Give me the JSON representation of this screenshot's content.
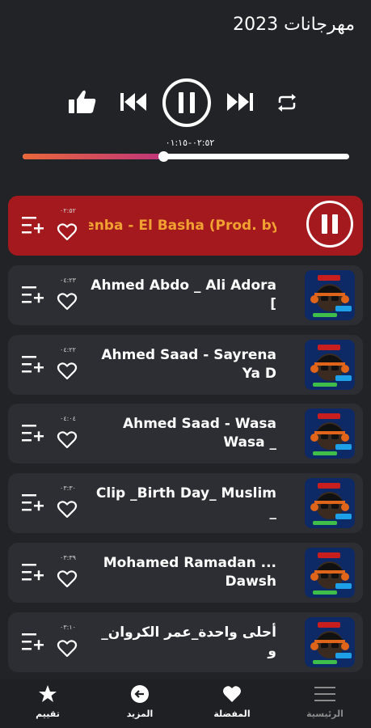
{
  "header": {
    "title": "مهرجانات 2023"
  },
  "player": {
    "current_time": "٠١:١٥",
    "total_time": "٠٢:٥٢",
    "separator": "-",
    "progress": 0.43,
    "like_icon": "thumbs-up-icon",
    "prev_icon": "skip-previous-icon",
    "play_pause_icon": "pause-circle-icon",
    "next_icon": "skip-next-icon",
    "repeat_icon": "repeat-icon"
  },
  "colors": {
    "background": "#222327",
    "card": "#2d2e33",
    "active_card": "#a3191d",
    "active_title": "#f0a132",
    "progress_start": "#e8673a",
    "progress_end": "#c0357a"
  },
  "tracks": [
    {
      "title": "enba - El Basha (Prod. by",
      "duration": "٠٢:٥٢",
      "active": true
    },
    {
      "title": "Ahmed Abdo _ Ali Adora [",
      "duration": "٠٤:٢٣",
      "active": false
    },
    {
      "title": "Ahmed Saad - Sayrena Ya D",
      "duration": "٠٤:٢٢",
      "active": false
    },
    {
      "title": "Ahmed Saad - Wasa Wasa _",
      "duration": "٠٤:٠٤",
      "active": false
    },
    {
      "title": "Clip _Birth Day_ Muslim _",
      "duration": "٠٣:٣٠",
      "active": false
    },
    {
      "title": "Mohamed Ramadan ... Dawsh",
      "duration": "٠٣:٣٩",
      "active": false
    },
    {
      "title": "_أحلى واحدة_عمر الكروان و",
      "duration": "٠٣:١٠",
      "active": false
    }
  ],
  "bottom_nav": [
    {
      "label": "تقييم",
      "icon": "star-icon",
      "active": true
    },
    {
      "label": "المزيد",
      "icon": "arrow-left-circle-icon",
      "active": true
    },
    {
      "label": "المفضلة",
      "icon": "heart-icon",
      "active": true
    },
    {
      "label": "الرئيسية",
      "icon": "menu-icon",
      "active": false
    }
  ]
}
